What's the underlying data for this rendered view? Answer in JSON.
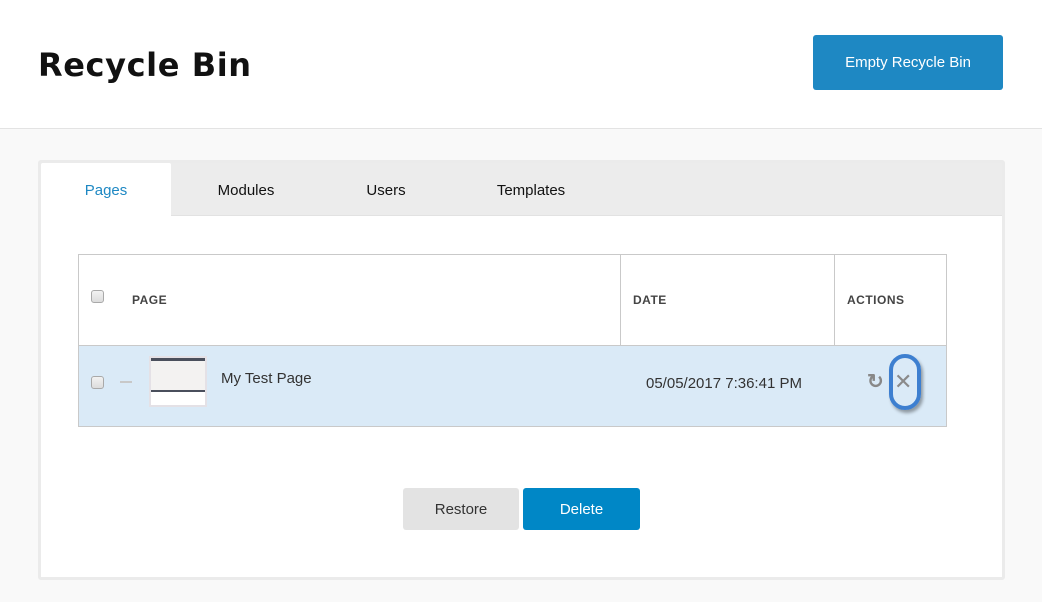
{
  "header": {
    "title": "Recycle Bin",
    "empty_button_label": "Empty Recycle Bin"
  },
  "tabs": [
    {
      "label": "Pages",
      "active": true
    },
    {
      "label": "Modules",
      "active": false
    },
    {
      "label": "Users",
      "active": false
    },
    {
      "label": "Templates",
      "active": false
    }
  ],
  "table": {
    "columns": [
      "PAGE",
      "DATE",
      "ACTIONS"
    ],
    "rows": [
      {
        "selected": false,
        "page": "My Test Page",
        "date": "05/05/2017 7:36:41 PM",
        "actions": [
          "restore-icon",
          "delete-icon"
        ]
      }
    ]
  },
  "icons": {
    "restore": "↻",
    "delete": "✕"
  },
  "footer_buttons": {
    "restore_label": "Restore",
    "delete_label": "Delete"
  },
  "colors": {
    "accent": "#1e88c3",
    "delete_button": "#0087c6",
    "row_highlight": "#daeaf7",
    "annotation_outline": "#3d7fd0"
  }
}
